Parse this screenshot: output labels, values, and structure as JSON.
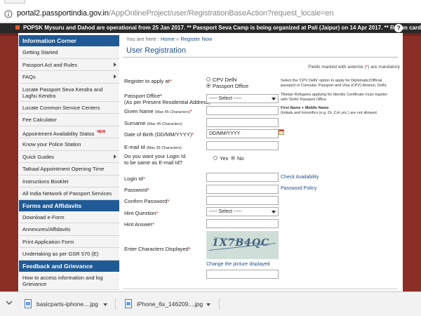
{
  "browser": {
    "url_host": "portal2.passportindia.gov.in",
    "url_path": "/AppOnlineProject/user/RegistrationBaseAction?request_locale=en"
  },
  "ticker": {
    "text": "POPSK Mysuru and Dahod are operational from 25 Jan 2017. ** Passport Seva Camp is being organized at Pali (Jaipur) on 14 Apr 2017. ** Ration card shall not be"
  },
  "sidebar": {
    "sections": [
      {
        "title": "Information Corner",
        "items": [
          {
            "label": "Getting Started"
          },
          {
            "label": "Passport Act and Rules",
            "chevron": true
          },
          {
            "label": "FAQs",
            "chevron": true
          },
          {
            "label": "Locate Passport Seva Kendra and Laghu Kendra",
            "tall": true
          },
          {
            "label": "Locate Common Service Centers"
          },
          {
            "label": "Fee Calculator"
          },
          {
            "label": "Appointment Availability Status",
            "badge": "NEW"
          },
          {
            "label": "Know your Police Station"
          },
          {
            "label": "Quick Guides",
            "chevron": true
          },
          {
            "label": "Tatkaal Appointment Opening Time"
          },
          {
            "label": "Instructions Booklet"
          },
          {
            "label": "All India Network of Passport Services"
          }
        ]
      },
      {
        "title": "Forms and Affidavits",
        "items": [
          {
            "label": "Download e-Form"
          },
          {
            "label": "Annexures/Affidavits"
          },
          {
            "label": "Print Application Form"
          },
          {
            "label": "Undertaking as per GSR 570 (E)"
          }
        ]
      },
      {
        "title": "Feedback and Grievance",
        "items": [
          {
            "label": "How to access information and log Grievance",
            "tall": true
          }
        ]
      }
    ]
  },
  "breadcrumb": {
    "prefix": "You are here :",
    "home": "Home",
    "separator": "»",
    "current": "Register Now"
  },
  "page_title": "User Registration",
  "mandatory_note": {
    "pre": "Fields marked with asterisk (",
    "ast": "*",
    "post": ") are mandatory"
  },
  "form": {
    "register_label": "Register to apply at",
    "register_options": [
      {
        "label": "CPV Delhi",
        "selected": false
      },
      {
        "label": "Passport Office",
        "selected": true
      }
    ],
    "register_note": [
      "Select the 'CPV Delhi' option to apply for Diplomatic/Official",
      "passport or Consular, Passport and Visa (CPV) division, Delhi."
    ],
    "passport_office_label": "Passport Office",
    "passport_office_sub": "(As per Present Residential Address)",
    "passport_office_value": "----- Select -----",
    "passport_office_note": [
      "Tibetan Refugees applying for Identity Certificate must register",
      "with 'Delhi' Passport Office."
    ],
    "given_name_label": "Given Name",
    "given_name_sub": "(Max 45 Characters)",
    "given_name_note_bold": "First Name + Middle Name",
    "given_name_note": "(Initials and honorifics (e.g. Dr.,Col.,etc.) are not allowed.",
    "surname_label": "Surname",
    "surname_sub": "(Max 45 Characters)",
    "dob_label": "Date of Birth (DD/MM/YYYY)",
    "dob_value": "DD/MM/YYYY",
    "email_label": "E-mail Id",
    "email_sub": "(Max 35 Characters)",
    "same_as_email_label_1": "Do you want your Login Id",
    "same_as_email_label_2": "to be same as E-mail Id?",
    "same_as_email_options": [
      {
        "label": "Yes",
        "selected": false
      },
      {
        "label": "No",
        "selected": true
      }
    ],
    "login_id_label": "Login Id",
    "check_availability": "Check Availability",
    "password_label": "Password",
    "password_policy": "Password Policy",
    "confirm_password_label": "Confirm Password",
    "hint_question_label": "Hint Question",
    "hint_question_value": "----- Select -----",
    "hint_answer_label": "Hint Answer",
    "captcha_label": "Enter Characters Displayed",
    "captcha_text": "1X7B4QC",
    "change_picture": "Change the picture displayed",
    "required_mark": "*"
  },
  "downloads": [
    {
      "name": "basicparts-iphone....jpg"
    },
    {
      "name": "iPhone_6s_146209....jpg"
    }
  ],
  "colors": {
    "sidebar_header": "#1f5a96",
    "link": "#1f4f8a",
    "backdrop": "#8b2e26",
    "ticker": "#292929",
    "required": "#dd0000"
  }
}
